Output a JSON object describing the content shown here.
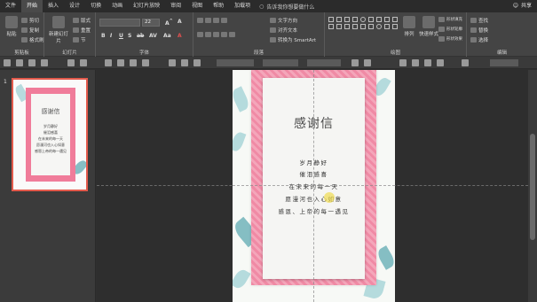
{
  "menubar": {
    "tabs": [
      "文件",
      "开始",
      "插入",
      "设计",
      "切换",
      "动画",
      "幻灯片放映",
      "审阅",
      "视图",
      "帮助",
      "加载项"
    ],
    "active_tab": "开始",
    "tell_me": "告诉我你想要做什么",
    "share": "共享"
  },
  "ribbon": {
    "clipboard": {
      "label": "剪贴板",
      "paste": "粘贴",
      "cut": "剪切",
      "copy": "复制",
      "format_painter": "格式刷"
    },
    "slides": {
      "label": "幻灯片",
      "new_slide": "新建幻灯片",
      "layout": "版式",
      "reset": "重置",
      "section": "节"
    },
    "font": {
      "label": "字体",
      "font_name": "",
      "font_size": "22",
      "buttons": [
        "B",
        "I",
        "U",
        "S",
        "ab",
        "AV",
        "Aa",
        "A"
      ]
    },
    "paragraph": {
      "label": "段落",
      "text_direction": "文字方向",
      "align_text": "对齐文本",
      "smartart": "转换为 SmartArt"
    },
    "drawing": {
      "label": "绘图",
      "arrange": "排列",
      "quick_styles": "快速样式",
      "shape_fill": "形状填充",
      "shape_outline": "形状轮廓",
      "shape_effects": "形状效果"
    },
    "editing": {
      "label": "编辑",
      "find": "查找",
      "replace": "替换",
      "select": "选择"
    }
  },
  "slide_pane": {
    "slide_number": "1",
    "thumb_title": "感谢信",
    "thumb_lines": [
      "岁月静好",
      "催泪感喜",
      "在未来的每一天",
      "愿漫河也入心如意",
      "感恩上帝的每一遇见"
    ]
  },
  "slide": {
    "title": "感谢信",
    "lines": [
      "岁月静好",
      "催泪感喜",
      "在未来的每一天",
      "愿漫河也入心如意",
      "感恩、上帝的每一遇见"
    ]
  },
  "colors": {
    "ribbon_bg": "#444444",
    "frame_pink": "#f08aa5",
    "thumb_border": "#e35a4c",
    "leaf": "#9fd0d4"
  }
}
